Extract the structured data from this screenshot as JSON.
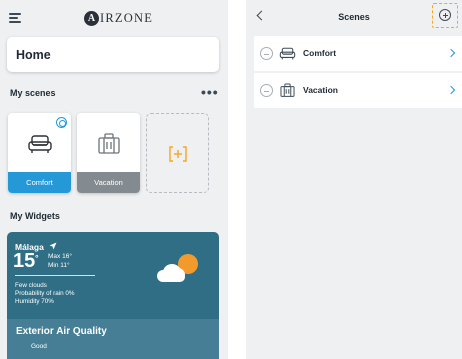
{
  "left_screen": {
    "brand": {
      "mark": "A",
      "text": "IRZONE"
    },
    "home_label": "Home",
    "my_scenes_title": "My scenes",
    "more_label": "•••",
    "scenes": [
      {
        "label": "Comfort",
        "icon": "sofa-icon",
        "active": true
      },
      {
        "label": "Vacation",
        "icon": "suitcase-icon",
        "active": false
      }
    ],
    "my_widgets_title": "My Widgets",
    "weather": {
      "city": "Málaga",
      "temperature": "15",
      "degree": "°",
      "max": "Max 16°",
      "min": "Min 11°",
      "description": "Few clouds",
      "rain": "Probability of rain 0%",
      "humidity": "Humidity 70%",
      "icon": "partly-cloudy-icon"
    },
    "air_quality": {
      "title": "Exterior Air Quality",
      "status": "Good"
    }
  },
  "right_screen": {
    "title": "Scenes",
    "scenes": [
      {
        "label": "Comfort",
        "icon": "sofa-icon"
      },
      {
        "label": "Vacation",
        "icon": "suitcase-icon"
      }
    ]
  },
  "colors": {
    "accent": "#2599d8",
    "highlight": "#f5a623",
    "widget_bg": "#2f6e85",
    "inactive_label": "#848b90"
  }
}
